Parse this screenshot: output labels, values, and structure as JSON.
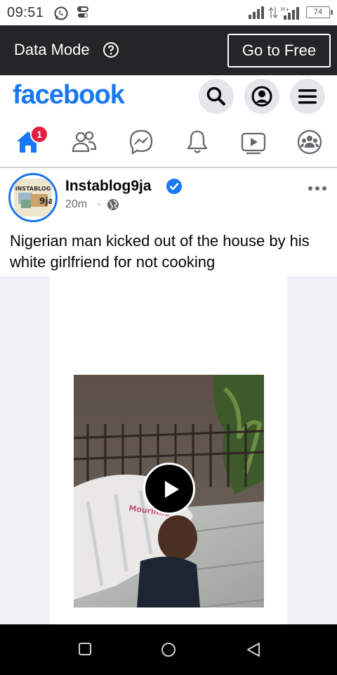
{
  "status_bar": {
    "time": "09:51",
    "battery": "74",
    "icons": [
      "whatsapp-icon",
      "toggle-icon",
      "signal-icon",
      "data-arrows-icon",
      "hplus-signal-icon",
      "battery-icon"
    ]
  },
  "data_bar": {
    "label": "Data Mode",
    "help_icon": "question-circle-icon",
    "go_free_label": "Go to Free"
  },
  "header": {
    "logo": "facebook",
    "buttons": [
      "search-icon",
      "profile-icon",
      "menu-icon"
    ]
  },
  "nav": {
    "tabs": [
      "home",
      "friends",
      "messenger",
      "notifications",
      "watch",
      "groups"
    ],
    "home_badge": "1",
    "active_tab": "home",
    "active_color": "#1877f2"
  },
  "post": {
    "author": "Instablog9ja",
    "verified": true,
    "time": "20m",
    "separator": "·",
    "privacy_icon": "globe-icon",
    "avatar_text": "INSTABLOG 9ja",
    "text": "Nigerian man kicked out of the house by his white girlfriend for not cooking",
    "video_caption_overlay": "Mourinho"
  },
  "colors": {
    "brand": "#1877f2",
    "dark_bar": "#242526",
    "badge": "#e41e3f"
  },
  "android_nav": [
    "recents-square-icon",
    "home-circle-icon",
    "back-triangle-icon"
  ]
}
